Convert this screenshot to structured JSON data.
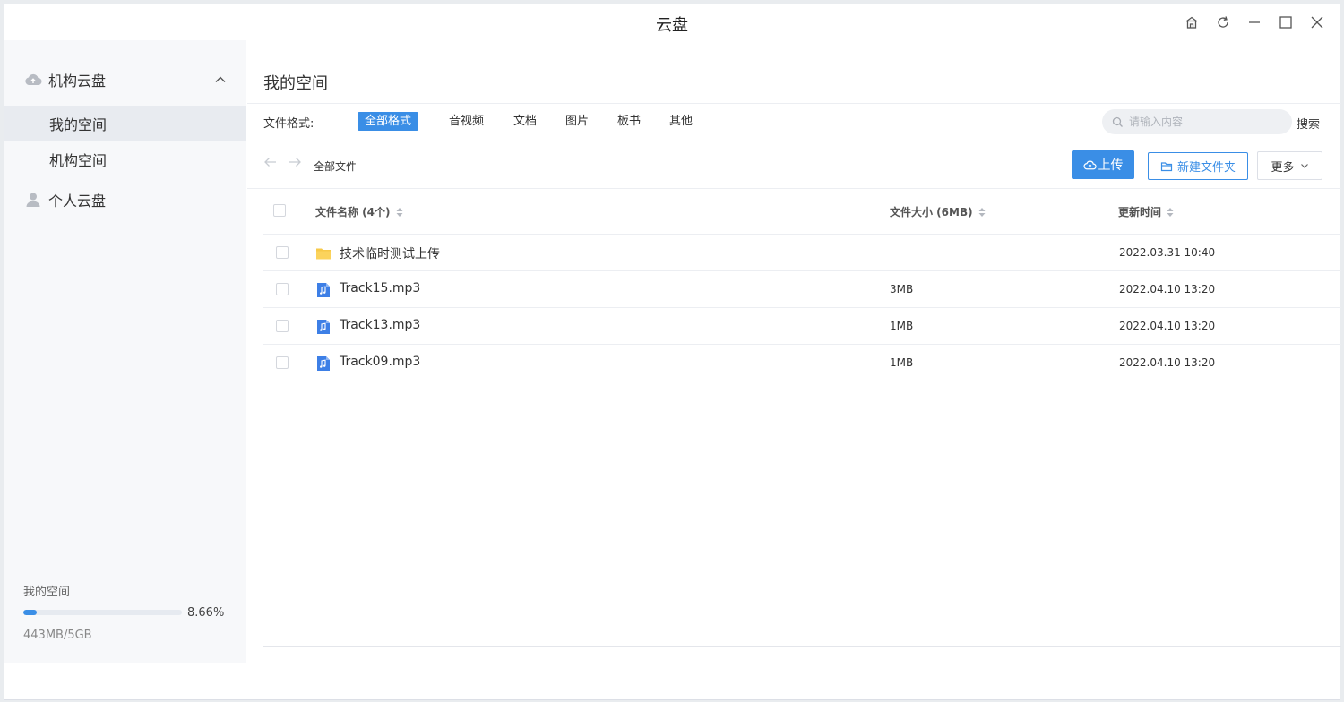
{
  "window": {
    "title": "云盘"
  },
  "sidebar": {
    "org_group": "机构云盘",
    "items": [
      {
        "label": "我的空间",
        "active": true
      },
      {
        "label": "机构空间",
        "active": false
      }
    ],
    "personal_group": "个人云盘",
    "storage": {
      "label": "我的空间",
      "percent_text": "8.66%",
      "percent": 8.66,
      "size_text": "443MB/5GB"
    }
  },
  "main": {
    "page_title": "我的空间",
    "filter": {
      "label": "文件格式:",
      "chips": [
        "全部格式",
        "音视频",
        "文档",
        "图片",
        "板书",
        "其他"
      ],
      "active_index": 0
    },
    "search": {
      "placeholder": "请输入内容",
      "button": "搜索"
    },
    "breadcrumb": "全部文件",
    "buttons": {
      "upload": "上传",
      "new_folder": "新建文件夹",
      "more": "更多"
    },
    "table": {
      "headers": {
        "name": "文件名称 (4个)",
        "size": "文件大小 (6MB)",
        "time": "更新时间"
      },
      "rows": [
        {
          "name": "技术临时测试上传",
          "type": "folder",
          "size": "-",
          "time": "2022.03.31 10:40"
        },
        {
          "name": "Track15.mp3",
          "type": "audio",
          "size": "3MB",
          "time": "2022.04.10 13:20"
        },
        {
          "name": "Track13.mp3",
          "type": "audio",
          "size": "1MB",
          "time": "2022.04.10 13:20"
        },
        {
          "name": "Track09.mp3",
          "type": "audio",
          "size": "1MB",
          "time": "2022.04.10 13:20"
        }
      ]
    }
  },
  "colors": {
    "accent": "#3a8ee6",
    "folder": "#f7c948",
    "audio": "#3d7fe6"
  }
}
